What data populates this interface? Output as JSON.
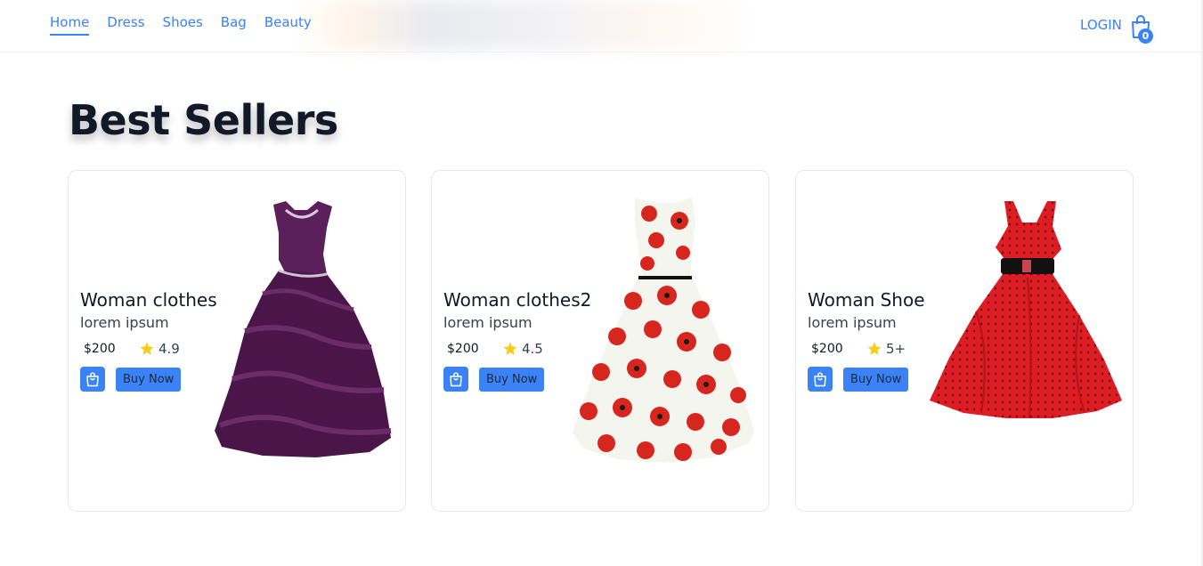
{
  "nav": {
    "links": [
      "Home",
      "Dress",
      "Shoes",
      "Bag",
      "Beauty"
    ],
    "active": "Home",
    "login_label": "LOGIN",
    "cart_count": "0"
  },
  "section": {
    "title": "Best Sellers"
  },
  "products": [
    {
      "name": "Woman clothes",
      "desc": "lorem ipsum",
      "price": "$200",
      "rating": "4.9",
      "buy_label": "Buy Now",
      "image": "purple-ruffled-gown"
    },
    {
      "name": "Woman clothes2",
      "desc": "lorem ipsum",
      "price": "$200",
      "rating": "4.5",
      "buy_label": "Buy Now",
      "image": "red-poppy-print-dress"
    },
    {
      "name": "Woman Shoe",
      "desc": "lorem ipsum",
      "price": "$200",
      "rating": "5+",
      "buy_label": "Buy Now",
      "image": "red-polka-dot-halter-dress"
    }
  ],
  "colors": {
    "accent": "#3b82f6",
    "star": "#facc15",
    "heading": "#111827"
  },
  "icons": {
    "cart": "shopping-bag-icon",
    "rating": "star-icon",
    "card_bag": "shopping-bag-icon"
  }
}
